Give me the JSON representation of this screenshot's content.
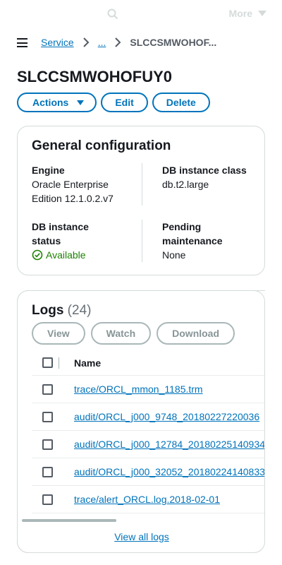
{
  "topnav": {
    "more_label": "More",
    "icons": {
      "search": "search-icon",
      "more_caret": "caret-down-icon"
    }
  },
  "breadcrumb": {
    "items": [
      "Service",
      "...",
      "SLCCSMWOHOF..."
    ],
    "icons": {
      "menu": "hamburger-menu-icon",
      "separator": "chevron-right-icon"
    }
  },
  "page": {
    "title": "SLCCSMWOHOFUY0"
  },
  "actions": {
    "actions_label": "Actions",
    "edit_label": "Edit",
    "delete_label": "Delete"
  },
  "general": {
    "title": "General configuration",
    "engine_label": "Engine",
    "engine_value": "Oracle Enterprise Edition 12.1.0.2.v7",
    "class_label": "DB instance class",
    "class_value": "db.t2.large",
    "status_label": "DB instance status",
    "status_value": "Available",
    "maint_label": "Pending maintenance",
    "maint_value": "None",
    "status_color": "#1d8102"
  },
  "logs": {
    "title": "Logs",
    "count": "(24)",
    "buttons": {
      "view": "View",
      "watch": "Watch",
      "download": "Download"
    },
    "column_name": "Name",
    "rows": [
      "trace/ORCL_mmon_1185.trm",
      "audit/ORCL_j000_9748_20180227220036",
      "audit/ORCL_j000_12784_20180225140934",
      "audit/ORCL_j000_32052_20180224140833",
      "trace/alert_ORCL.log.2018-02-01"
    ],
    "view_all": "View all logs"
  },
  "colors": {
    "link": "#0073bb",
    "text": "#16191f",
    "border": "#d5dbdb"
  }
}
